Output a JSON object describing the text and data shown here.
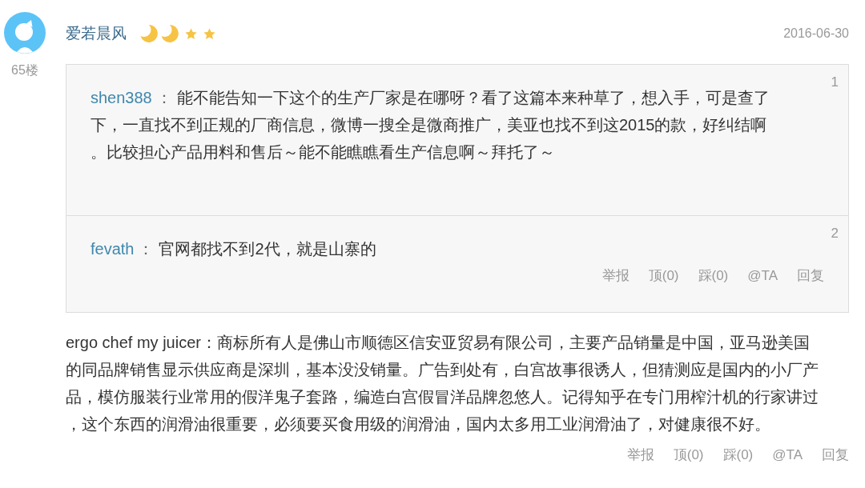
{
  "comment": {
    "username": "爱若晨风",
    "level_icons": [
      {
        "kind": "moon"
      },
      {
        "kind": "moon"
      },
      {
        "kind": "star"
      },
      {
        "kind": "star"
      }
    ],
    "date": "2016-06-30",
    "floor": "65楼",
    "quotes": [
      {
        "number": "1",
        "author": "shen388",
        "separator": "：",
        "text": "能不能告知一下这个的生产厂家是在哪呀？看了这篇本来种草了，想入手，可是查了下，一直找不到正规的厂商信息，微博一搜全是微商推广，美亚也找不到这2015的款，好纠结啊。比较担心产品用料和售后～能不能瞧瞧看生产信息啊～拜托了～"
      },
      {
        "number": "2",
        "author": "fevath",
        "separator": "：",
        "text": "官网都找不到2代，就是山寨的",
        "actions": [
          "举报",
          "顶(0)",
          "踩(0)",
          "@TA",
          "回复"
        ]
      }
    ],
    "text": "ergo chef my juicer：商标所有人是佛山市顺德区信安亚贸易有限公司，主要产品销量是中国，亚马逊美国的同品牌销售显示供应商是深圳，基本没没销量。广告到处有，白宫故事很诱人，但猜测应是国内的小厂产品，模仿服装行业常用的假洋鬼子套路，编造白宫假冒洋品牌忽悠人。记得知乎在专门用榨汁机的行家讲过，这个东西的润滑油很重要，必须要买食用级的润滑油，国内太多用工业润滑油了，对健康很不好。",
    "actions": [
      "举报",
      "顶(0)",
      "踩(0)",
      "@TA",
      "回复"
    ]
  }
}
